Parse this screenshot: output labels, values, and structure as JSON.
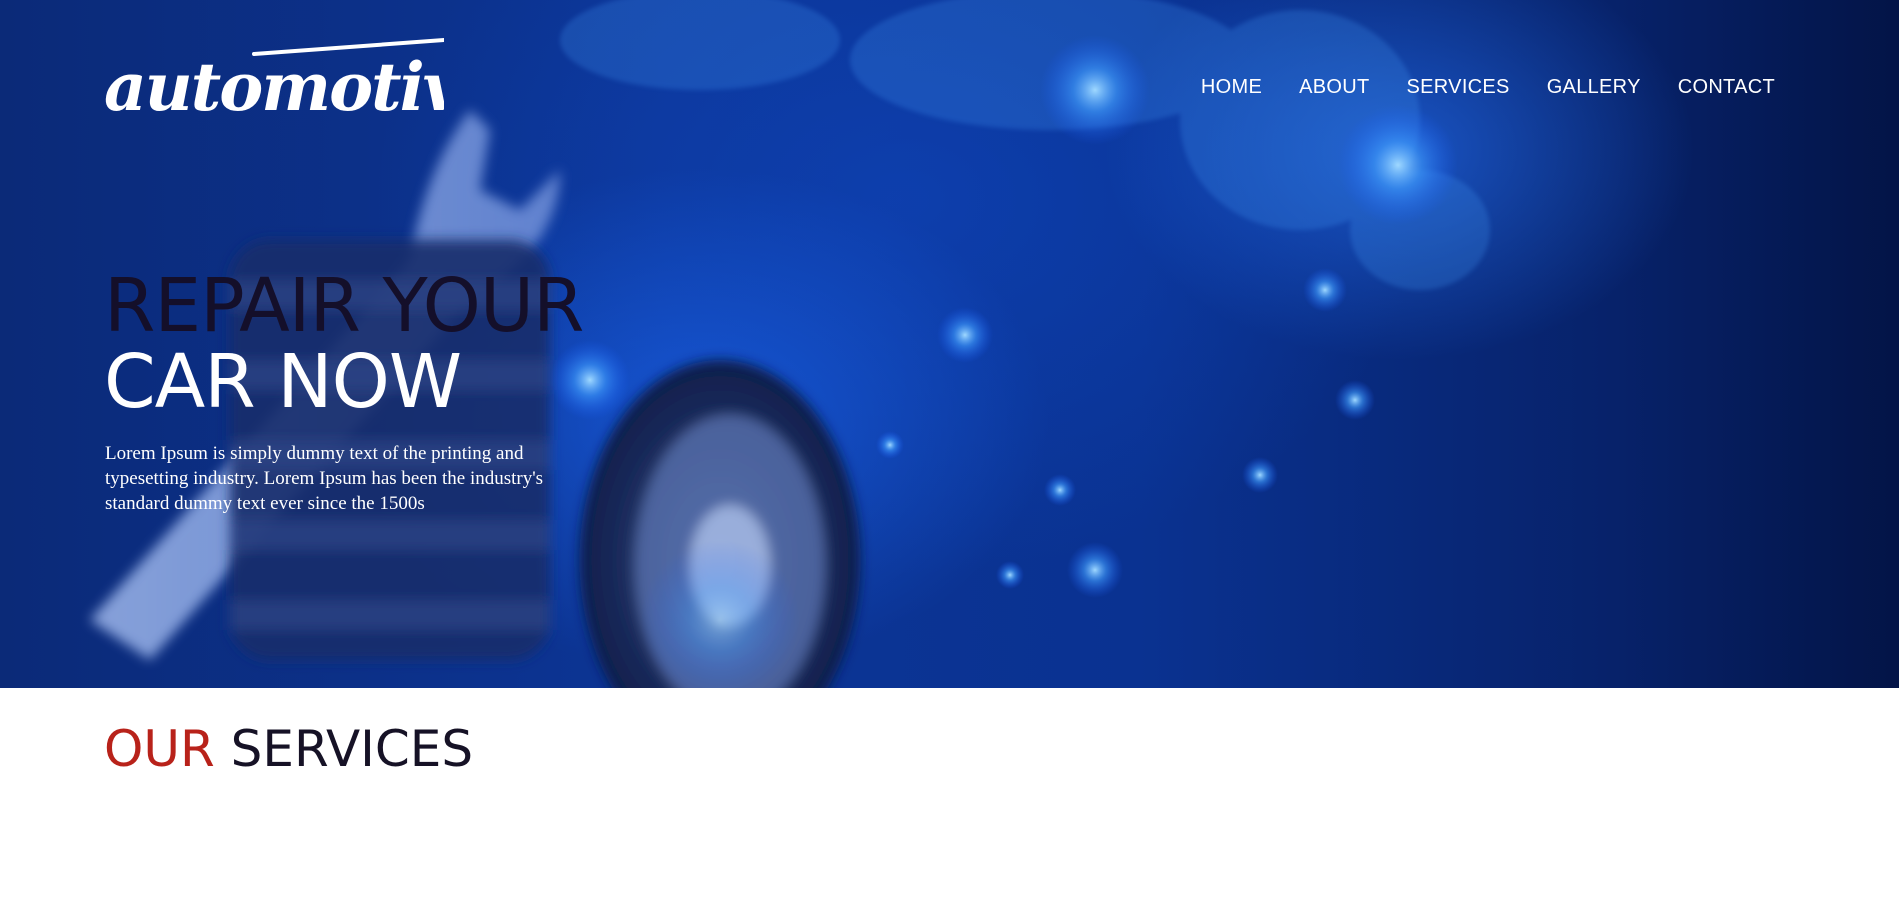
{
  "brand": {
    "logo_text": "automotive"
  },
  "nav": {
    "items": [
      {
        "label": "HOME"
      },
      {
        "label": "ABOUT"
      },
      {
        "label": "SERVICES"
      },
      {
        "label": "GALLERY"
      },
      {
        "label": "CONTACT"
      }
    ]
  },
  "hero": {
    "headline_line1": "REPAIR YOUR",
    "headline_line2": "CAR NOW",
    "description": "Lorem Ipsum is simply dummy text of the printing and typesetting industry. Lorem Ipsum has been the industry's standard dummy text ever since the 1500s",
    "background_image": "blurred wrench and stacked tyres over blue world map"
  },
  "services": {
    "title_accent": "OUR",
    "title_rest": "SERVICES"
  },
  "colors": {
    "hero_blue": "#0c3596",
    "headline_dark": "#140f2a",
    "accent_red": "#b8221a",
    "nav_text": "#ffffff"
  }
}
